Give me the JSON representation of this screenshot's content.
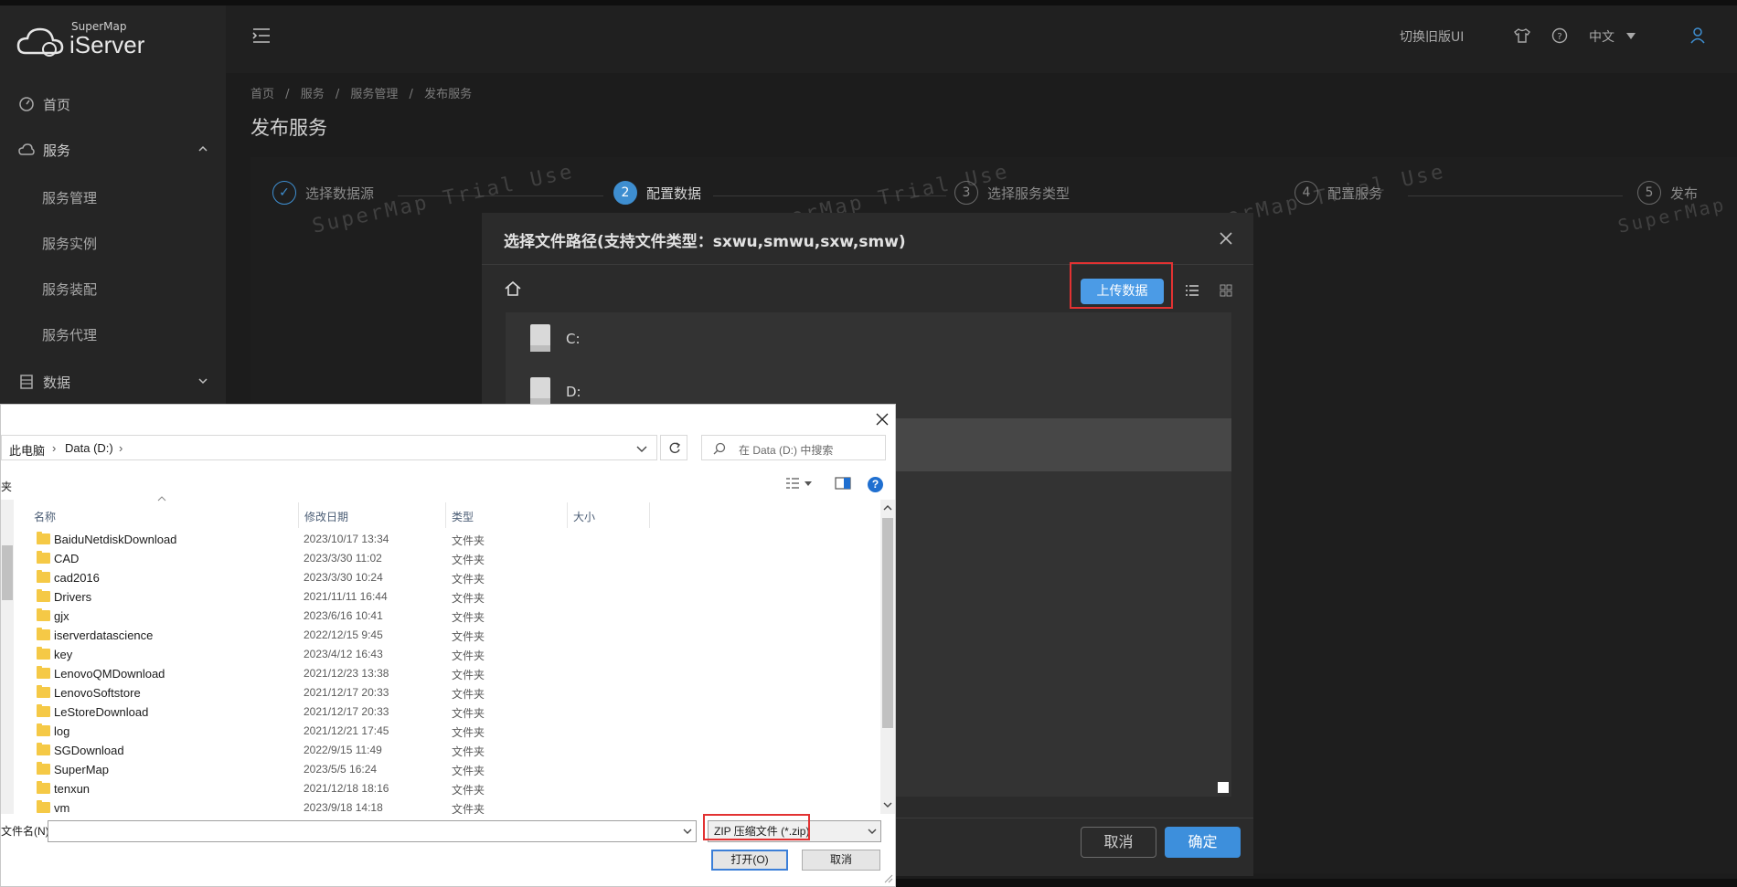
{
  "app": {
    "logo_small": "SuperMap",
    "logo_big": "iServer",
    "topbar": {
      "switch_ui": "切换旧版UI",
      "language": "中文"
    }
  },
  "sidebar": {
    "items": [
      {
        "label": "首页"
      },
      {
        "label": "服务"
      },
      {
        "label": "服务管理"
      },
      {
        "label": "服务实例"
      },
      {
        "label": "服务装配"
      },
      {
        "label": "服务代理"
      },
      {
        "label": "数据"
      }
    ]
  },
  "breadcrumb": {
    "home": "首页",
    "services": "服务",
    "service_mgmt": "服务管理",
    "publish": "发布服务",
    "sep": "/"
  },
  "page_title": "发布服务",
  "steps": [
    {
      "num": "",
      "label": "选择数据源"
    },
    {
      "num": "2",
      "label": "配置数据"
    },
    {
      "num": "3",
      "label": "选择服务类型"
    },
    {
      "num": "4",
      "label": "配置服务"
    },
    {
      "num": "5",
      "label": "发布"
    }
  ],
  "watermark": "SuperMap Trial Use",
  "web_dialog": {
    "title": "选择文件路径(支持文件类型：sxwu,smwu,sxw,smw)",
    "upload_label": "上传数据",
    "drives": [
      {
        "label": "C:"
      },
      {
        "label": "D:"
      }
    ],
    "cancel_label": "取消",
    "ok_label": "确定"
  },
  "file_dialog": {
    "address": {
      "root": "此电脑",
      "drive": "Data (D:)"
    },
    "search_placeholder": "在 Data (D:) 中搜索",
    "left_edge_text": "夹",
    "columns": {
      "name": "名称",
      "date": "修改日期",
      "type": "类型",
      "size": "大小"
    },
    "rows": [
      {
        "name": "BaiduNetdiskDownload",
        "date": "2023/10/17 13:34",
        "type": "文件夹"
      },
      {
        "name": "CAD",
        "date": "2023/3/30 11:02",
        "type": "文件夹"
      },
      {
        "name": "cad2016",
        "date": "2023/3/30 10:24",
        "type": "文件夹"
      },
      {
        "name": "Drivers",
        "date": "2021/11/11 16:44",
        "type": "文件夹"
      },
      {
        "name": "gjx",
        "date": "2023/6/16 10:41",
        "type": "文件夹"
      },
      {
        "name": "iserverdatascience",
        "date": "2022/12/15 9:45",
        "type": "文件夹"
      },
      {
        "name": "key",
        "date": "2023/4/12 16:43",
        "type": "文件夹"
      },
      {
        "name": "LenovoQMDownload",
        "date": "2021/12/23 13:38",
        "type": "文件夹"
      },
      {
        "name": "LenovoSoftstore",
        "date": "2021/12/17 20:33",
        "type": "文件夹"
      },
      {
        "name": "LeStoreDownload",
        "date": "2021/12/17 20:33",
        "type": "文件夹"
      },
      {
        "name": "log",
        "date": "2021/12/21 17:45",
        "type": "文件夹"
      },
      {
        "name": "SGDownload",
        "date": "2022/9/15 11:49",
        "type": "文件夹"
      },
      {
        "name": "SuperMap",
        "date": "2023/5/5 16:24",
        "type": "文件夹"
      },
      {
        "name": "tenxun",
        "date": "2021/12/18 18:16",
        "type": "文件夹"
      },
      {
        "name": "vm",
        "date": "2023/9/18 14:18",
        "type": "文件夹"
      }
    ],
    "filename_label": "文件名(N):",
    "filename_value": "",
    "filetype_value": "ZIP 压缩文件 (*.zip)",
    "open_label": "打开(O)",
    "cancel_label": "取消"
  },
  "colors": {
    "accent": "#3e8ed0",
    "highlight": "#e23232",
    "folder": "#f5c946"
  }
}
